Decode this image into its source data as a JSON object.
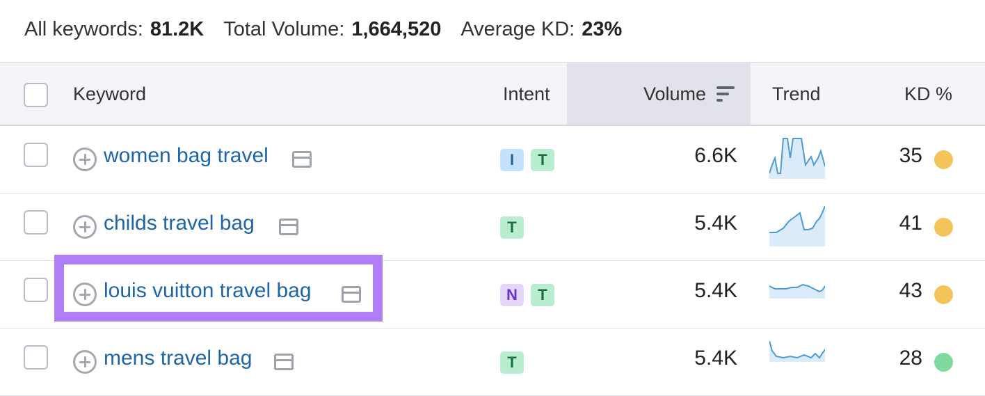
{
  "summary": {
    "all_keywords_label": "All keywords:",
    "all_keywords_value": "81.2K",
    "total_volume_label": "Total Volume:",
    "total_volume_value": "1,664,520",
    "avg_kd_label": "Average KD:",
    "avg_kd_value": "23%"
  },
  "columns": {
    "keyword": "Keyword",
    "intent": "Intent",
    "volume": "Volume",
    "trend": "Trend",
    "kd": "KD %"
  },
  "rows": [
    {
      "keyword": "women bag travel",
      "intents": [
        "I",
        "T"
      ],
      "volume": "6.6K",
      "kd": "35",
      "kd_color": "#f2c45a",
      "trend_icon": "sparkline-trend-icon"
    },
    {
      "keyword": "childs travel bag",
      "intents": [
        "T"
      ],
      "volume": "5.4K",
      "kd": "41",
      "kd_color": "#f2c45a",
      "trend_icon": "sparkline-trend-icon"
    },
    {
      "keyword": "louis vuitton travel bag",
      "intents": [
        "N",
        "T"
      ],
      "volume": "5.4K",
      "kd": "43",
      "kd_color": "#f2c45a",
      "trend_icon": "sparkline-trend-icon",
      "highlighted": true
    },
    {
      "keyword": "mens travel bag",
      "intents": [
        "T"
      ],
      "volume": "5.4K",
      "kd": "28",
      "kd_color": "#7fdaa0",
      "trend_icon": "sparkline-trend-icon"
    }
  ],
  "colors": {
    "link": "#1e64a8",
    "highlight_border": "#b07ef5",
    "intent_I_bg": "#c6e2fb",
    "intent_T_bg": "#b8edd0",
    "intent_N_bg": "#e4d6fb",
    "trend_line": "#4a9bd6",
    "trend_fill": "#dcebfa"
  }
}
